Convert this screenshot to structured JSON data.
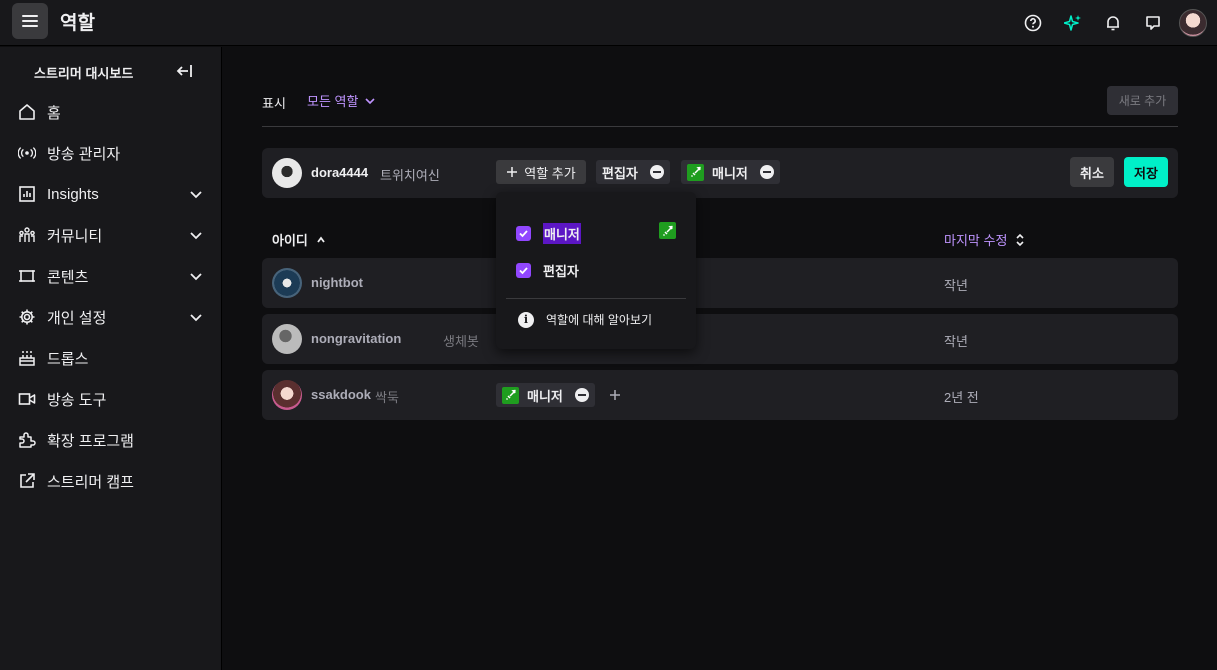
{
  "header": {
    "title": "역할"
  },
  "sidebar": {
    "header": "스트리머 대시보드",
    "items": [
      {
        "label": "홈",
        "icon": "home-icon"
      },
      {
        "label": "방송 관리자",
        "icon": "broadcast-icon"
      },
      {
        "label": "Insights",
        "icon": "insights-icon",
        "expandable": true
      },
      {
        "label": "커뮤니티",
        "icon": "community-icon",
        "expandable": true
      },
      {
        "label": "콘텐츠",
        "icon": "content-icon",
        "expandable": true
      },
      {
        "label": "개인 설정",
        "icon": "gear-icon",
        "expandable": true
      },
      {
        "label": "드롭스",
        "icon": "drops-icon"
      },
      {
        "label": "방송 도구",
        "icon": "camera-icon"
      },
      {
        "label": "확장 프로그램",
        "icon": "extension-icon"
      },
      {
        "label": "스트리머 캠프",
        "icon": "external-link-icon"
      }
    ]
  },
  "filter": {
    "label": "표시",
    "selected": "모든 역할"
  },
  "add_new_button": "새로 추가",
  "edit_row": {
    "username": "dora4444",
    "display_name": "트위치여신",
    "add_role_label": "역할 추가",
    "roles": [
      "편집자",
      "매니저"
    ],
    "cancel_label": "취소",
    "save_label": "저장"
  },
  "table": {
    "col_id": "아이디",
    "col_modified": "마지막 수정",
    "rows": [
      {
        "username": "nightbot",
        "display_name": "",
        "modified": "작년"
      },
      {
        "username": "nongravitation",
        "display_name": "생체봇",
        "modified": "작년"
      },
      {
        "username": "ssakdook",
        "display_name": "싹둑",
        "role": "매니저",
        "modified": "2년 전"
      }
    ]
  },
  "dropdown": {
    "options": [
      {
        "label": "매니저",
        "checked": true
      },
      {
        "label": "편집자",
        "checked": true
      }
    ],
    "info_label": "역할에 대해 알아보기"
  },
  "colors": {
    "accent": "#9147ff",
    "accent_text": "#bf94ff",
    "save": "#00f0c8",
    "moderator_badge": "#1f9d1f"
  }
}
